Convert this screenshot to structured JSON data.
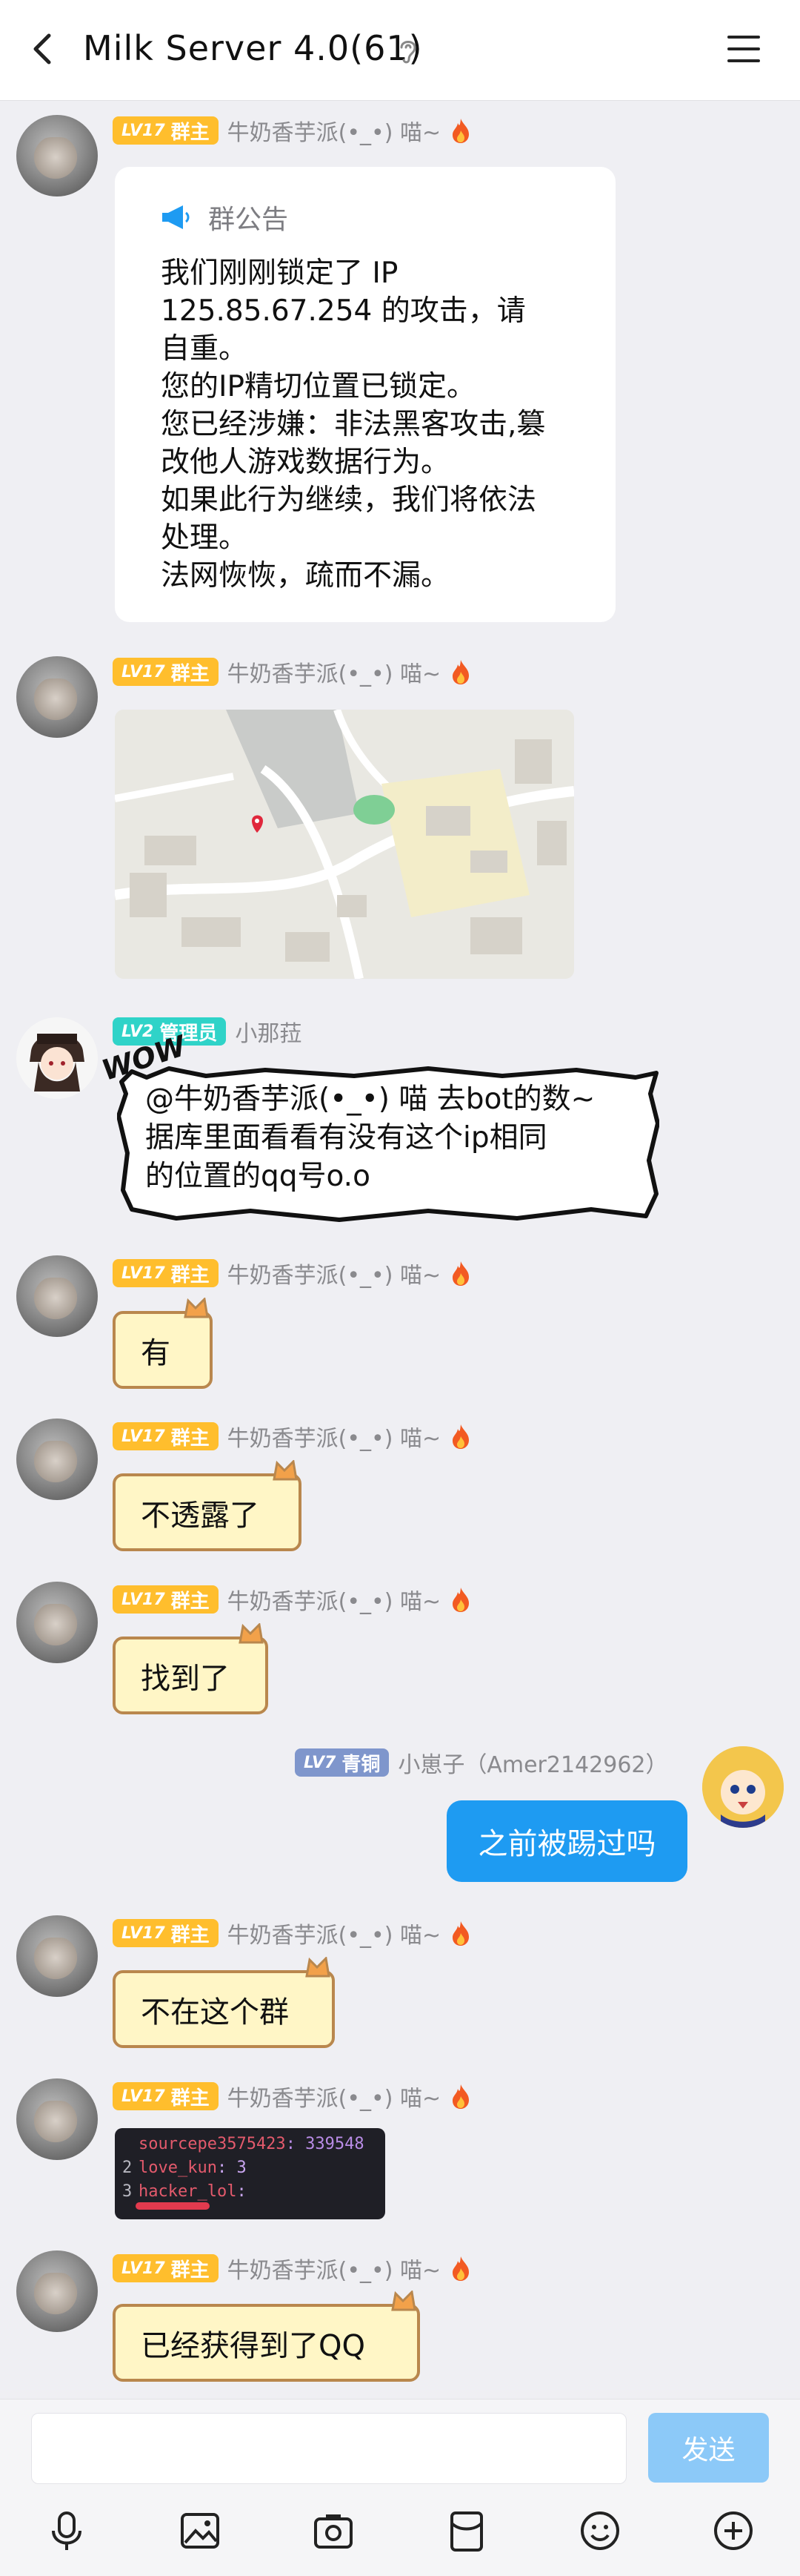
{
  "header": {
    "title": "Milk Server 4.0(61)"
  },
  "roles": {
    "owner": {
      "level": "LV17",
      "title": "群主",
      "color": "#ffbe2d"
    },
    "admin": {
      "level": "LV2",
      "title": "管理员",
      "color": "#2fd3c8"
    },
    "member": {
      "level": "LV7",
      "title": "青铜",
      "color": "#7f96cc"
    }
  },
  "senders": {
    "owner": "牛奶香芋派(•_•) 喵~",
    "admin": "小那菈",
    "self": "小崽子（Amer2142962）"
  },
  "notice": {
    "title": "群公告",
    "lines": [
      "我们刚刚锁定了 IP",
      "125.85.67.254 的攻击，请",
      "自重。",
      "您的IP精切位置已锁定。",
      "您已经涉嫌：非法黑客攻击,篡",
      "改他人游戏数据行为。",
      "如果此行为继续，我们将依法",
      "处理。",
      "法网恢恢，疏而不漏。"
    ]
  },
  "comic": {
    "wow": "WOW",
    "lines": [
      "@牛奶香芋派(•_•) 喵 去bot的数~",
      "据库里面看看有没有这个ip相同",
      "的位置的qq号o.o"
    ]
  },
  "messages": {
    "m1": "有",
    "m2": "不透露了",
    "m3": "找到了",
    "self1": "之前被踢过吗",
    "m4": "不在这个群",
    "m5": "已经获得到了QQ"
  },
  "code_image": {
    "lines": [
      {
        "n": "",
        "key": "sourcepe3575423",
        "val": ": 339548"
      },
      {
        "n": "2",
        "key": "love_kun",
        "val": ": 3"
      },
      {
        "n": "3",
        "key": "hacker_lol",
        "val": ":"
      }
    ]
  },
  "input": {
    "send": "发送"
  },
  "colors": {
    "accent": "#1e9bf2",
    "send_disabled": "#8cc9f8",
    "background": "#efeff3"
  },
  "icons": [
    "back-icon",
    "ear-icon",
    "menu-icon",
    "fire-icon",
    "megaphone-icon",
    "mic-icon",
    "picture-icon",
    "camera-icon",
    "red-packet-icon",
    "emoji-icon",
    "plus-icon"
  ]
}
